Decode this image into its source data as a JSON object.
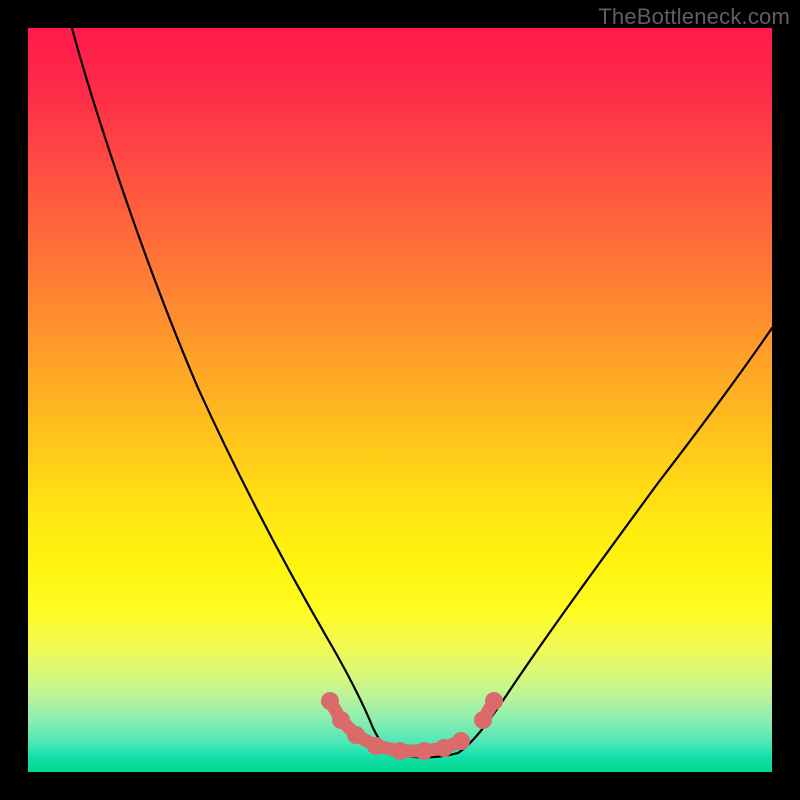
{
  "watermark": {
    "text": "TheBottleneck.com"
  },
  "chart_data": {
    "type": "line",
    "title": "",
    "xlabel": "",
    "ylabel": "",
    "xlim": [
      0,
      100
    ],
    "ylim": [
      0,
      100
    ],
    "note": "V-shaped curve over pink→yellow→green vertical gradient; no axes shown. Numbers estimated from pixel positions (top=100, bottom=0).",
    "series": [
      {
        "name": "left-branch",
        "x": [
          6,
          10,
          15,
          20,
          25,
          30,
          35,
          38,
          40,
          42,
          44,
          46
        ],
        "y": [
          100,
          88,
          74,
          60,
          47,
          34,
          22,
          15,
          11,
          8,
          5,
          3
        ]
      },
      {
        "name": "valley-floor",
        "x": [
          46,
          50,
          54,
          58
        ],
        "y": [
          3,
          2.5,
          2.5,
          3
        ]
      },
      {
        "name": "right-branch",
        "x": [
          58,
          62,
          66,
          72,
          78,
          84,
          90,
          96,
          100
        ],
        "y": [
          3,
          6,
          10,
          18,
          27,
          36,
          46,
          56,
          63
        ]
      }
    ],
    "markers": {
      "name": "highlighted-segment",
      "points_xy": [
        [
          40.5,
          9.5
        ],
        [
          42,
          7
        ],
        [
          44,
          5
        ],
        [
          47,
          3.3
        ],
        [
          50,
          2.8
        ],
        [
          53,
          2.8
        ],
        [
          56,
          3.2
        ],
        [
          58,
          4
        ],
        [
          61,
          7
        ],
        [
          62.5,
          9.5
        ]
      ]
    },
    "gradient_stops": [
      {
        "pos": 0.0,
        "color": "#ff1a4b"
      },
      {
        "pos": 0.5,
        "color": "#ffc91a"
      },
      {
        "pos": 0.78,
        "color": "#fffb20"
      },
      {
        "pos": 1.0,
        "color": "#00d88f"
      }
    ]
  }
}
